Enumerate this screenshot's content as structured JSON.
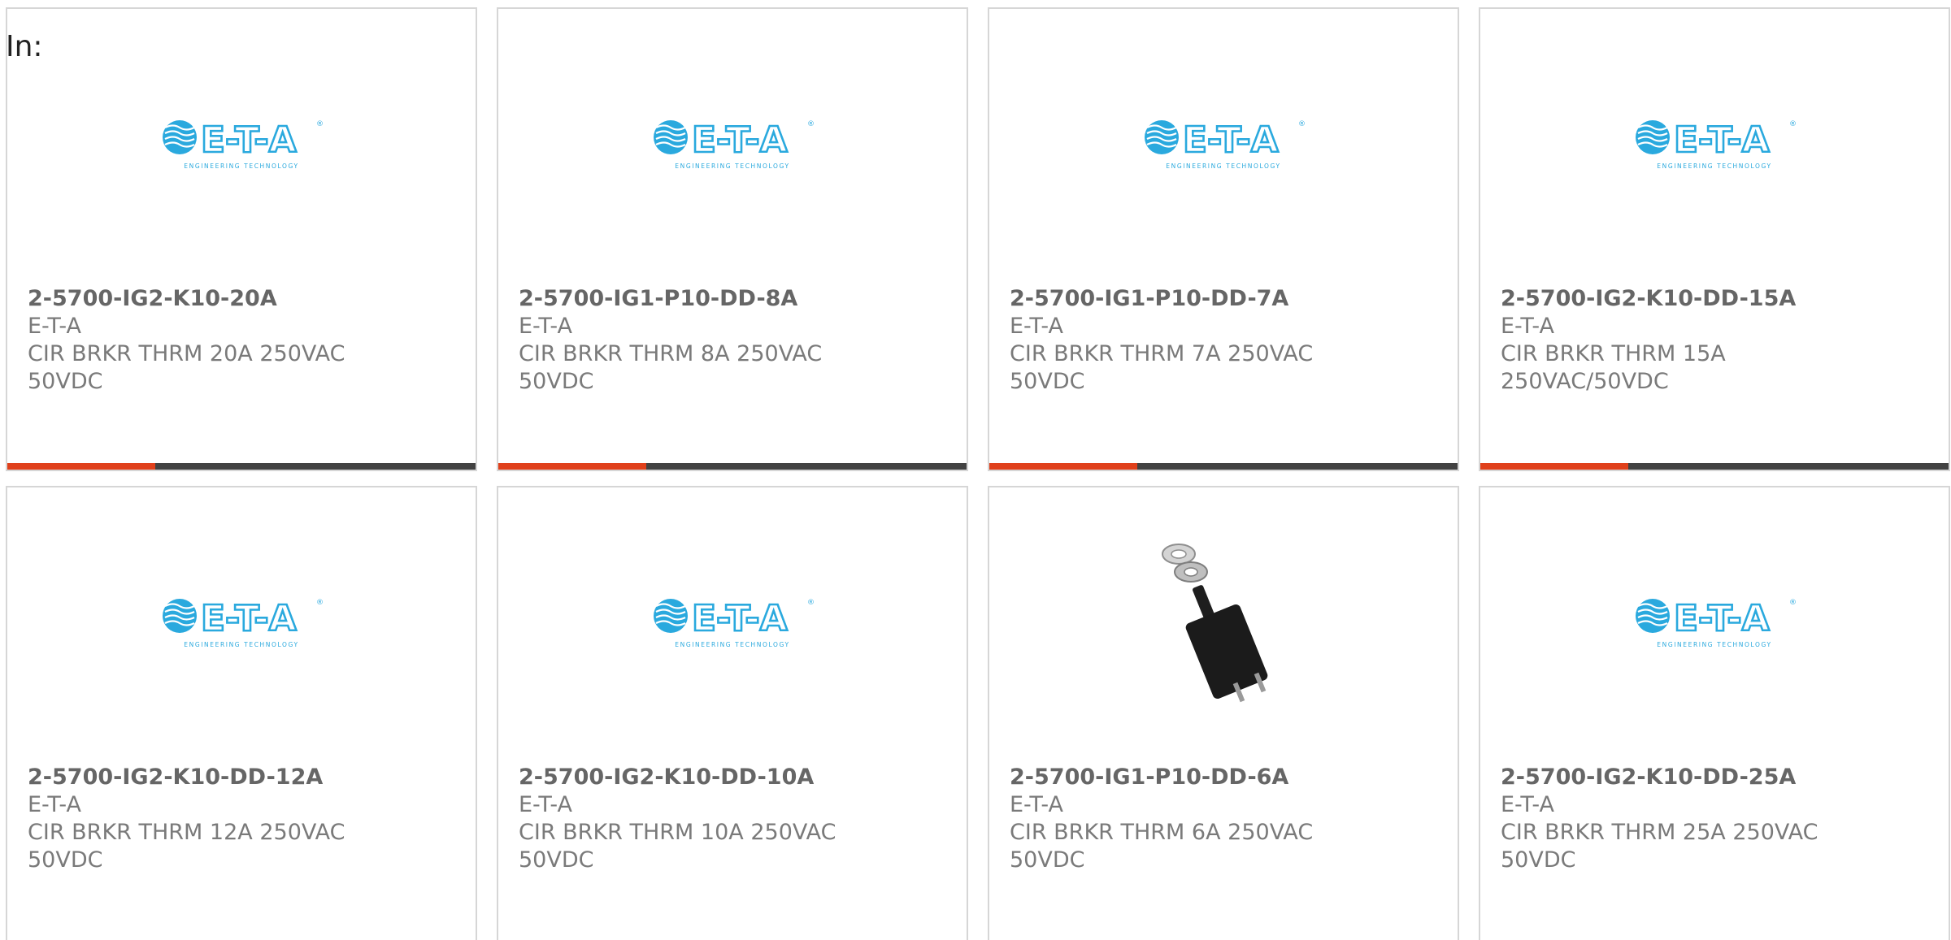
{
  "filter": {
    "label": "In:"
  },
  "colors": {
    "accent": "#e0401b",
    "bar": "#424242",
    "logo": "#2aa9de",
    "card_border": "#d6d6d6"
  },
  "products": [
    {
      "part_number": "2-5700-IG2-K10-20A",
      "manufacturer": "E-T-A",
      "description": "CIR BRKR THRM 20A 250VAC 50VDC",
      "image": "eta-logo",
      "logo_tagline": "ENGINEERING TECHNOLOGY"
    },
    {
      "part_number": "2-5700-IG1-P10-DD-8A",
      "manufacturer": "E-T-A",
      "description": "CIR BRKR THRM 8A 250VAC 50VDC",
      "image": "eta-logo",
      "logo_tagline": "ENGINEERING TECHNOLOGY"
    },
    {
      "part_number": "2-5700-IG1-P10-DD-7A",
      "manufacturer": "E-T-A",
      "description": "CIR BRKR THRM 7A 250VAC 50VDC",
      "image": "eta-logo",
      "logo_tagline": "ENGINEERING TECHNOLOGY"
    },
    {
      "part_number": "2-5700-IG2-K10-DD-15A",
      "manufacturer": "E-T-A",
      "description": "CIR BRKR THRM 15A 250VAC/50VDC",
      "image": "eta-logo",
      "logo_tagline": "ENGINEERING TECHNOLOGY"
    },
    {
      "part_number": "2-5700-IG2-K10-DD-12A",
      "manufacturer": "E-T-A",
      "description": "CIR BRKR THRM 12A 250VAC 50VDC",
      "image": "eta-logo",
      "logo_tagline": "ENGINEERING TECHNOLOGY"
    },
    {
      "part_number": "2-5700-IG2-K10-DD-10A",
      "manufacturer": "E-T-A",
      "description": "CIR BRKR THRM 10A 250VAC 50VDC",
      "image": "eta-logo",
      "logo_tagline": "ENGINEERING TECHNOLOGY"
    },
    {
      "part_number": "2-5700-IG1-P10-DD-6A",
      "manufacturer": "E-T-A",
      "description": "CIR BRKR THRM 6A 250VAC 50VDC",
      "image": "circuit-breaker-photo"
    },
    {
      "part_number": "2-5700-IG2-K10-DD-25A",
      "manufacturer": "E-T-A",
      "description": "CIR BRKR THRM 25A 250VAC 50VDC",
      "image": "eta-logo",
      "logo_tagline": "ENGINEERING TECHNOLOGY"
    }
  ]
}
